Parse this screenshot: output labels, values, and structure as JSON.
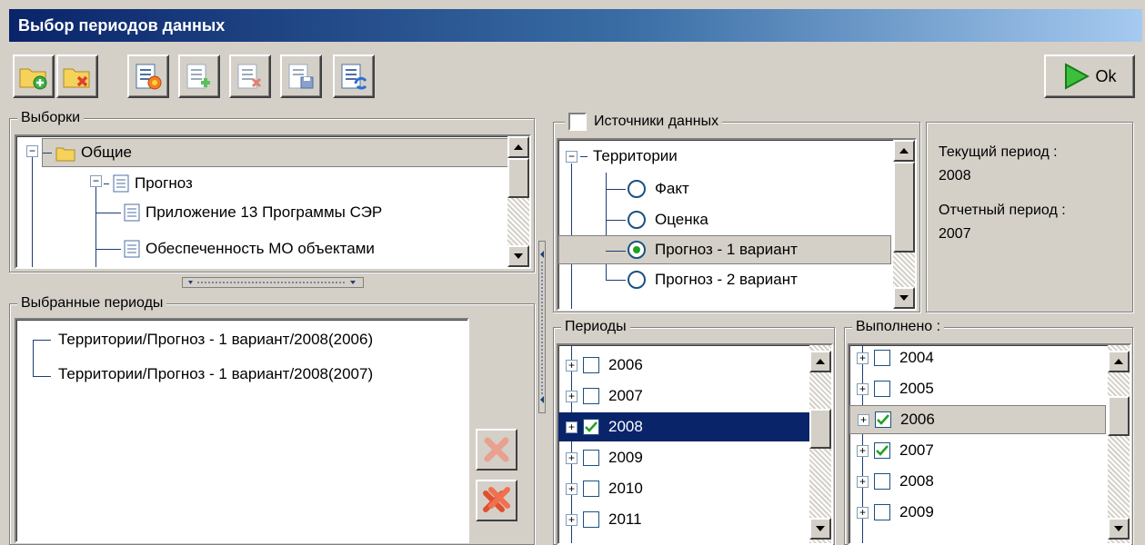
{
  "window": {
    "title": "Выбор периодов данных"
  },
  "toolbar": {
    "buttons": [
      {
        "icon": "folder-add-icon"
      },
      {
        "icon": "folder-delete-icon"
      },
      {
        "icon": "list-new-icon"
      },
      {
        "icon": "list-add-icon"
      },
      {
        "icon": "list-delete-icon"
      },
      {
        "icon": "list-save-icon"
      },
      {
        "icon": "list-refresh-icon"
      }
    ],
    "ok_label": "Ok"
  },
  "samples": {
    "title": "Выборки",
    "items": [
      {
        "label": "Общие",
        "icon": "folder-icon"
      },
      {
        "label": "Прогноз",
        "icon": "document-icon"
      },
      {
        "label": "Приложение 13 Программы СЭР",
        "icon": "document-icon"
      },
      {
        "label": "Обеспеченность МО объектами",
        "icon": "document-icon"
      }
    ]
  },
  "selected_periods": {
    "title": "Выбранные периоды",
    "items": [
      "Территории/Прогноз - 1 вариант/2008(2006)",
      "Территории/Прогноз - 1 вариант/2008(2007)"
    ]
  },
  "sources": {
    "title": "Источники данных",
    "checked": false,
    "root": "Территории",
    "options": [
      {
        "label": "Факт",
        "selected": false
      },
      {
        "label": "Оценка",
        "selected": false
      },
      {
        "label": "Прогноз - 1 вариант",
        "selected": true
      },
      {
        "label": "Прогноз - 2 вариант",
        "selected": false
      }
    ]
  },
  "info": {
    "current_label": "Текущий период :",
    "current_value": "2008",
    "reporting_label": "Отчетный период :",
    "reporting_value": "2007"
  },
  "periods": {
    "title": "Периоды",
    "items": [
      {
        "label": "2006",
        "checked": false
      },
      {
        "label": "2007",
        "checked": false
      },
      {
        "label": "2008",
        "checked": true
      },
      {
        "label": "2009",
        "checked": false
      },
      {
        "label": "2010",
        "checked": false
      },
      {
        "label": "2011",
        "checked": false
      }
    ]
  },
  "done": {
    "title": "Выполнено :",
    "items": [
      {
        "label": "2004",
        "checked": false
      },
      {
        "label": "2005",
        "checked": false
      },
      {
        "label": "2006",
        "checked": true
      },
      {
        "label": "2007",
        "checked": true
      },
      {
        "label": "2008",
        "checked": false
      },
      {
        "label": "2009",
        "checked": false
      }
    ]
  },
  "colors": {
    "accent": "#0a246a",
    "check": "#21a121",
    "delete": "#e06040"
  }
}
